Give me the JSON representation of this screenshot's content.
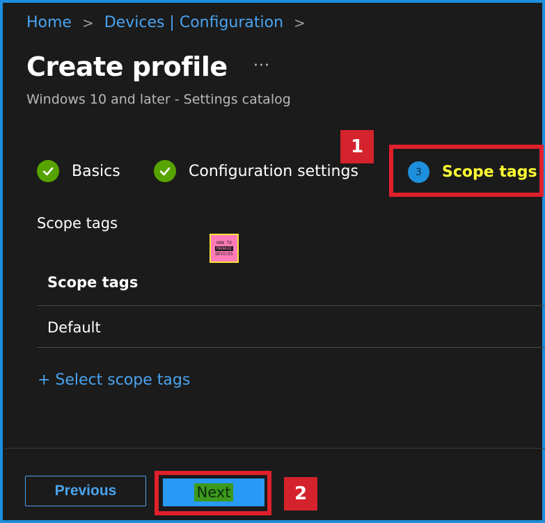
{
  "breadcrumb": {
    "items": [
      "Home",
      "Devices | Configuration"
    ],
    "separator": ">"
  },
  "header": {
    "title": "Create profile",
    "more_glyph": "···",
    "subtitle": "Windows 10 and later - Settings catalog"
  },
  "wizard": {
    "steps": [
      {
        "label": "Basics",
        "state": "completed"
      },
      {
        "label": "Configuration settings",
        "state": "completed"
      },
      {
        "number": "3",
        "label": "Scope tags",
        "state": "current"
      }
    ]
  },
  "callouts": [
    "1",
    "2"
  ],
  "watermark": {
    "lines": [
      "HOW TO",
      "MANAGE",
      "DEVICES"
    ]
  },
  "scope": {
    "section_label": "Scope tags",
    "table": {
      "header": "Scope tags",
      "rows": [
        "Default"
      ]
    },
    "add_link": "+ Select scope tags"
  },
  "footer": {
    "previous_label": "Previous",
    "next_label": "Next"
  },
  "colors": {
    "accent": "#1e8fdc",
    "link": "#4aa3ef",
    "success": "#57a300",
    "highlight": "#ffff33",
    "callout": "#e0202b",
    "background": "#1b1b1b"
  }
}
